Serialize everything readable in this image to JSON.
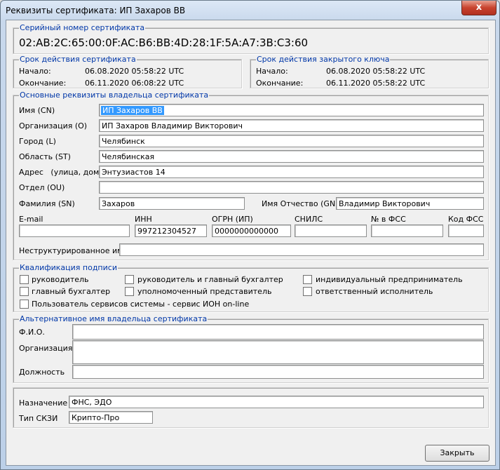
{
  "window": {
    "title": "Реквизиты сертификата: ИП Захаров ВВ",
    "close_glyph": "x"
  },
  "serial": {
    "legend": "Серийный номер сертификата",
    "value": "02:AB:2C:65:00:0F:AC:B6:BB:4D:28:1F:5A:A7:3B:C3:60"
  },
  "cert_validity": {
    "legend": "Срок действия сертификата",
    "start_label": "Начало:",
    "start": "06.08.2020 05:58:22 UTC",
    "end_label": "Окончание:",
    "end": "06.11.2020 06:08:22 UTC"
  },
  "key_validity": {
    "legend": "Срок действия закрытого ключа",
    "start_label": "Начало:",
    "start": "06.08.2020 05:58:22 UTC",
    "end_label": "Окончание:",
    "end": "06.11.2020 05:58:22 UTC"
  },
  "owner": {
    "legend": "Основные реквизиты владельца сертификата",
    "cn_label": "Имя (CN)",
    "cn": "ИП Захаров ВВ",
    "org_label": "Организация (O)",
    "org": "ИП Захаров Владимир Викторович",
    "city_label": "Город (L)",
    "city": "Челябинск",
    "region_label": "Область (ST)",
    "region": "Челябинская",
    "address_label": "Адрес   (улица, дом)",
    "address": "Энтузиастов 14",
    "dept_label": "Отдел (OU)",
    "dept": "",
    "surname_label": "Фамилия (SN)",
    "surname": "Захаров",
    "given_label": "Имя Отчество (GN)",
    "given": "Владимир Викторович",
    "email_label": "E-mail",
    "email": "",
    "inn_label": "ИНН",
    "inn": "997212304527",
    "ogrn_label": "ОГРН (ИП)",
    "ogrn": "0000000000000",
    "snils_label": "СНИЛС",
    "snils": "",
    "fss_label": "№ в ФСС",
    "fss": "",
    "fss_code_label": "Код ФСС",
    "fss_code": "",
    "unstructured_label": "Неструктурированное имя",
    "unstructured": ""
  },
  "qualification": {
    "legend": "Квалификация подписи",
    "items": [
      "руководитель",
      "руководитель и главный бухгалтер",
      "индивидуальный предприниматель",
      "главный бухгалтер",
      "уполномоченный представитель",
      "ответственный исполнитель",
      "Пользователь сервисов системы - сервис ИОН on-line"
    ],
    "checked": [
      false,
      false,
      false,
      false,
      false,
      false,
      false
    ]
  },
  "alt_name": {
    "legend": "Альтернативное имя владельца сертификата",
    "fio_label": "Ф.И.О.",
    "fio": "",
    "org_label": "Организация",
    "org": "",
    "position_label": "Должность",
    "position": ""
  },
  "purpose": {
    "label": "Назначение",
    "value": "ФНС, ЭДО",
    "crypto_label": "Тип СКЗИ",
    "crypto": "Крипто-Про"
  },
  "buttons": {
    "close": "Закрыть"
  }
}
